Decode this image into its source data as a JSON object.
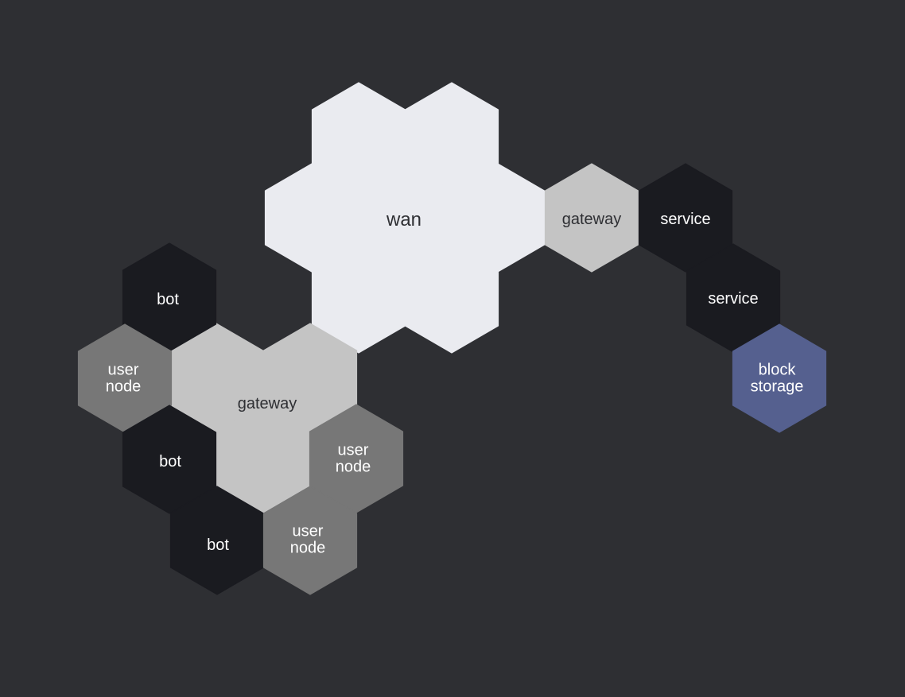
{
  "colors": {
    "background": "#2e2f33",
    "wan": "#eaebf0",
    "gateway": "#c4c4c4",
    "user_node": "#777777",
    "dark": "#1a1b20",
    "block_storage": "#55608f",
    "text_dark": "#2e2f33",
    "text_light": "#ffffff"
  },
  "diagram": {
    "nodes": [
      {
        "key": "wan",
        "label": "wan",
        "kind": "wan",
        "size": "large"
      },
      {
        "key": "gateway_top",
        "label": "gateway",
        "kind": "gateway",
        "size": "small"
      },
      {
        "key": "service_1",
        "label": "service",
        "kind": "dark",
        "size": "small"
      },
      {
        "key": "service_2",
        "label": "service",
        "kind": "dark",
        "size": "small"
      },
      {
        "key": "block_storage",
        "label": "block\nstorage",
        "kind": "block_storage",
        "size": "small"
      },
      {
        "key": "gateway_main",
        "label": "gateway",
        "kind": "gateway",
        "size": "large"
      },
      {
        "key": "bot_1",
        "label": "bot",
        "kind": "dark",
        "size": "small"
      },
      {
        "key": "user_node_1",
        "label": "user\nnode",
        "kind": "user_node",
        "size": "small"
      },
      {
        "key": "bot_2",
        "label": "bot",
        "kind": "dark",
        "size": "small"
      },
      {
        "key": "user_node_2",
        "label": "user\nnode",
        "kind": "user_node",
        "size": "small"
      },
      {
        "key": "bot_3",
        "label": "bot",
        "kind": "dark",
        "size": "small"
      },
      {
        "key": "user_node_3",
        "label": "user\nnode",
        "kind": "user_node",
        "size": "small"
      }
    ]
  }
}
